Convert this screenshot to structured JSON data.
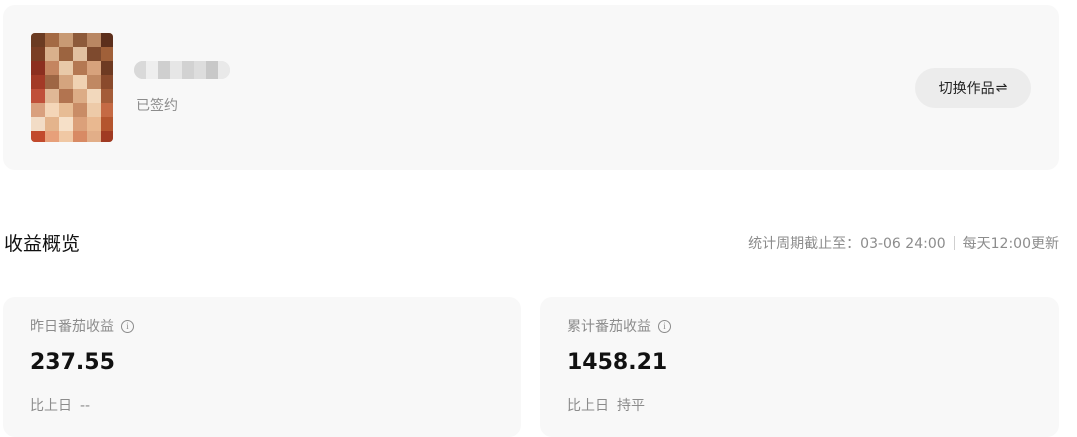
{
  "work": {
    "status": "已签约",
    "switch_label": "切换作品",
    "switch_icon": "swap-arrows-icon"
  },
  "overview": {
    "title": "收益概览",
    "period_text": "统计周期截止至：03-06 24:00",
    "update_text": "每天12:00更新"
  },
  "stats": [
    {
      "label": "昨日番茄收益",
      "value": "237.55",
      "compare_label": "比上日",
      "compare_value": "--"
    },
    {
      "label": "累计番茄收益",
      "value": "1458.21",
      "compare_label": "比上日",
      "compare_value": "持平"
    }
  ],
  "colors": {
    "card_bg": "#f8f8f8",
    "button_bg": "#ececec",
    "muted_text": "#8c8c8c",
    "primary_text": "#111111"
  }
}
